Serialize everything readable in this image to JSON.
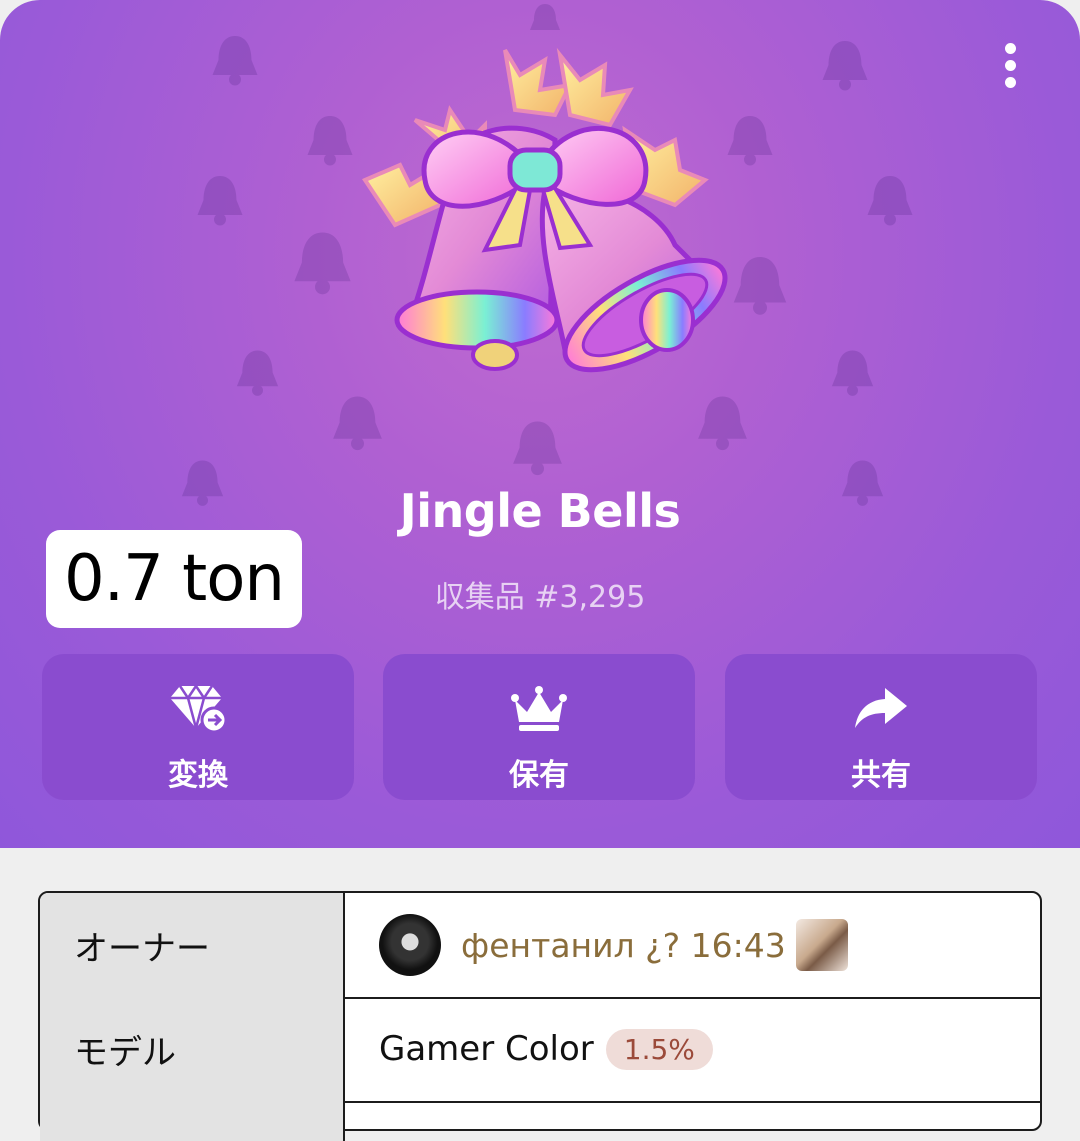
{
  "header": {
    "title": "Jingle Bells",
    "subtitle": "収集品 #3,295",
    "more_icon": "more-vertical-icon"
  },
  "price_overlay": {
    "text": "0.7 ton"
  },
  "actions": [
    {
      "label": "変換",
      "icon": "diamond-convert-icon"
    },
    {
      "label": "保有",
      "icon": "crown-icon"
    },
    {
      "label": "共有",
      "icon": "share-arrow-icon"
    }
  ],
  "details": {
    "owner": {
      "key": "オーナー",
      "name": "фентанил ¿? 16:43"
    },
    "model": {
      "key": "モデル",
      "value": "Gamer Color",
      "rarity": "1.5%"
    }
  },
  "colors": {
    "hero_background": "#9a5ad8",
    "action_button": "#8a4ccf",
    "owner_text": "#8a6d3b",
    "rarity_badge": "#efdcd8"
  }
}
